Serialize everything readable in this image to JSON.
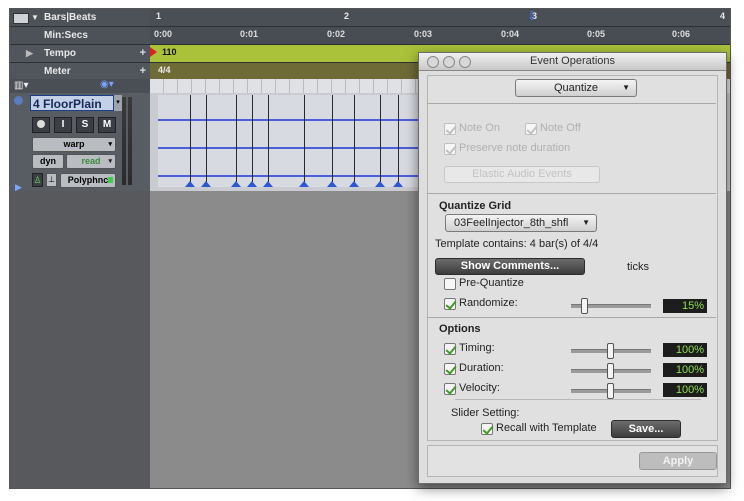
{
  "rulers": {
    "bars_beats": {
      "label": "Bars|Beats",
      "ticks": [
        "1",
        "2",
        "3",
        "4"
      ]
    },
    "min_secs": {
      "label": "Min:Secs",
      "ticks": [
        "0:00",
        "0:01",
        "0:02",
        "0:03",
        "0:04",
        "0:05",
        "0:06"
      ]
    },
    "tempo": {
      "label": "Tempo",
      "value": "110"
    },
    "meter": {
      "label": "Meter",
      "value": "4/4"
    }
  },
  "track": {
    "name": "4 FloorPlain",
    "buttons": {
      "record": "",
      "input": "I",
      "solo": "S",
      "mute": "M"
    },
    "mode": "warp",
    "dyn": "dyn",
    "automation": "read",
    "elastic": "Polyphnc"
  },
  "dialog": {
    "title": "Event Operations",
    "operation": "Quantize",
    "note_on": "Note On",
    "note_off": "Note Off",
    "preserve": "Preserve note duration",
    "elastic_events": "Elastic Audio Events",
    "grid_heading": "Quantize Grid",
    "grid_value": "03FeelInjector_8th_shfl",
    "template_text": "Template contains: 4 bar(s) of 4/4",
    "show_comments": "Show Comments...",
    "ticks": "ticks",
    "pre_quantize": "Pre-Quantize",
    "randomize": "Randomize:",
    "randomize_value": "15%",
    "options_heading": "Options",
    "timing": "Timing:",
    "timing_value": "100%",
    "duration": "Duration:",
    "duration_value": "100%",
    "velocity": "Velocity:",
    "velocity_value": "100%",
    "slider_setting": "Slider Setting:",
    "recall": "Recall with Template",
    "save": "Save...",
    "apply": "Apply"
  },
  "colors": {
    "tempo_bar": "#a9c23a",
    "meter_bar": "#6e6b37",
    "waveform": "#4b5fd6",
    "value_text": "#8de14a"
  }
}
